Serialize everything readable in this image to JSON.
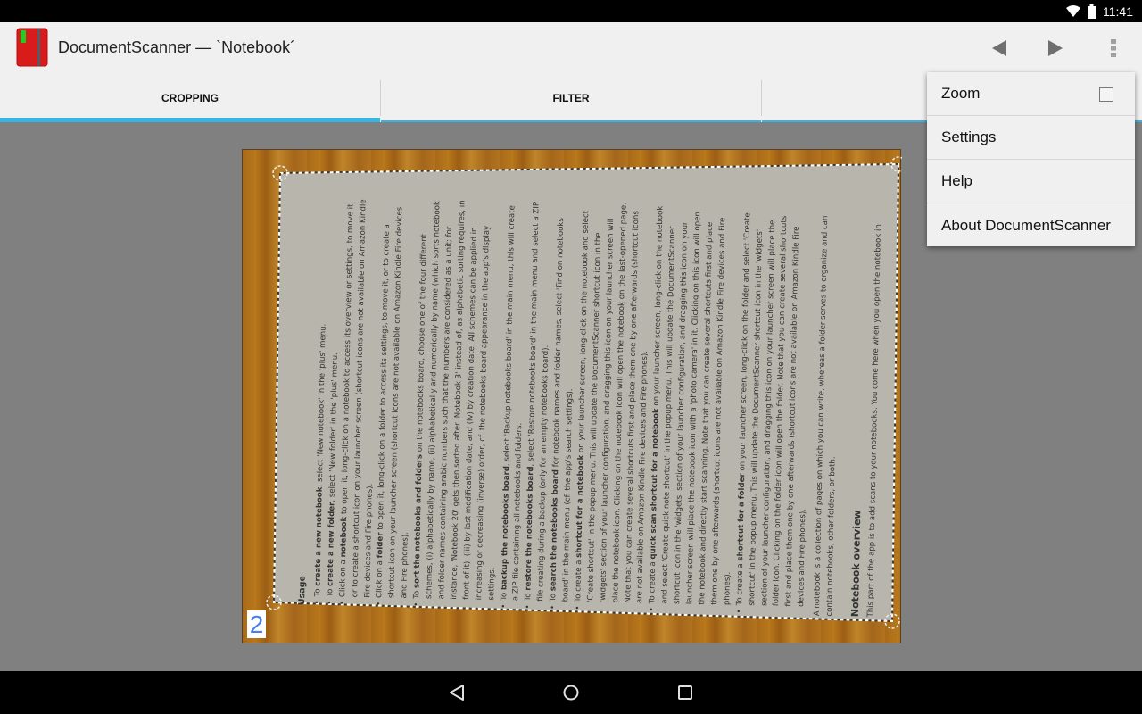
{
  "status_bar": {
    "time": "11:41",
    "icons": [
      "wifi-icon",
      "battery-icon"
    ]
  },
  "action_bar": {
    "title": "DocumentScanner — `Notebook´",
    "app_icon": "notebook-icon",
    "buttons": [
      {
        "name": "previous-page-button",
        "icon": "triangle-left-icon"
      },
      {
        "name": "next-page-button",
        "icon": "triangle-right-icon"
      },
      {
        "name": "overflow-menu-button",
        "icon": "more-vert-icon"
      }
    ]
  },
  "tabs": [
    {
      "label": "CROPPING",
      "selected": true
    },
    {
      "label": "FILTER",
      "selected": false
    },
    {
      "label": "",
      "selected": false
    }
  ],
  "colors": {
    "accent": "#33b5e5",
    "bar_bg": "#f0f0f0",
    "content_bg": "#808080",
    "page_number": "#4a7df0"
  },
  "overflow_menu": {
    "items": [
      {
        "label": "Zoom",
        "checkbox": true,
        "checked": false
      },
      {
        "label": "Settings"
      },
      {
        "label": "Help"
      },
      {
        "label": "About DocumentScanner"
      }
    ]
  },
  "document": {
    "page_number": "2",
    "heading": "Usage",
    "items": [
      {
        "pre": "To ",
        "bold": "create a new notebook",
        "post": ", select 'New notebook' in the 'plus' menu."
      },
      {
        "pre": "To ",
        "bold": "create a new folder",
        "post": ", select 'New folder' in the 'plus' menu."
      },
      {
        "pre": "Click on a ",
        "bold": "notebook",
        "post": " to open it, long-click on a notebook to access its overview or settings, to move it, or to create a shortcut icon on your launcher screen (shortcut icons are not available on Amazon Kindle Fire devices and Fire phones)."
      },
      {
        "pre": "Click on a ",
        "bold": "folder",
        "post": " to open it, long-click on a folder to access its settings, to move it, or to create a shortcut icon on your launcher screen (shortcut icons are not available on Amazon Kindle Fire devices and Fire phones)."
      },
      {
        "pre": "To ",
        "bold": "sort the notebooks and folders",
        "post": " on the notebooks board, choose one of the four different schemes, (i) alphabetically by name, (ii) alphabetically and numerically by name (which sorts notebook and folder names containing arabic numbers such that the numbers are considered as a unit; for instance, 'Notebook 20' gets then sorted after 'Notebook 3' instead of, as alphabetic sorting requires, in front of it), (iii) by last modification date, and (iv) by creation date. All schemes can be applied in increasing or decreasing (inverse) order, cf. the notebooks board appearance in the app's display settings."
      },
      {
        "pre": "To ",
        "bold": "backup the notebooks board",
        "post": ", select 'Backup notebooks board' in the main menu, this will create a ZIP file containing all notebooks and folders."
      },
      {
        "pre": "To ",
        "bold": "restore the notebooks board",
        "post": ", select 'Restore notebooks board' in the main menu and select a ZIP file creating during a backup (only for an empty notebooks board)."
      },
      {
        "pre": "To ",
        "bold": "search the notebooks board",
        "post": " for notebook names and folder names, select 'Find on notebooks board' in the main menu (cf. the app's search settings)."
      },
      {
        "pre": "To create a ",
        "bold": "shortcut for a notebook",
        "post": " on your launcher screen, long-click on the notebook and select 'Create shortcut' in the popup menu. This will update the DocumentScanner shortcut icon in the 'widgets' section of your launcher configuration, and dragging this icon on your launcher screen will place the notebook icon. Clicking on the notebook icon will open the notebook on the last-opened page. Note that you can create several shortcuts first and place them one by one afterwards (shortcut icons are not available on Amazon Kindle Fire devices and Fire phones)."
      },
      {
        "pre": "To create a ",
        "bold": "quick scan shortcut for a notebook",
        "post": " on your launcher screen, long-click on the notebook and select 'Create quick note shortcut' in the popup menu. This will update the DocumentScanner shortcut icon in the 'widgets' section of your launcher configuration, and dragging this icon on your launcher screen will place the notebook icon with a 'photo camera' in it. Clicking on this icon will open the notebook and directly start scanning. Note that you can create several shortcuts first and place them one by one afterwards (shortcut icons are not available on Amazon Kindle Fire devices and Fire phones)."
      },
      {
        "pre": "To create a ",
        "bold": "shortcut for a folder",
        "post": " on your launcher screen, long-click on the folder and select 'Create shortcut' in the popup menu. This will update the DocumentScanner shortcut icon in the 'widgets' section of your launcher configuration, and dragging this icon on your launcher screen will place the folder icon. Clicking on the folder icon will open the folder. Note that you can create several shortcuts first and place them one by one afterwards (shortcut icons are not available on Amazon Kindle Fire devices and Fire phones)."
      }
    ],
    "paragraph": "A notebook is a collection of pages on which you can write, whereas a folder serves to organize and can contain notebooks, other folders, or both.",
    "heading2": "Notebook overview",
    "paragraph2": "This part of the app is to add scans to your notebooks. You come here when you open the notebook in"
  },
  "nav_bar": {
    "buttons": [
      "back-icon",
      "home-icon",
      "recents-icon"
    ]
  }
}
